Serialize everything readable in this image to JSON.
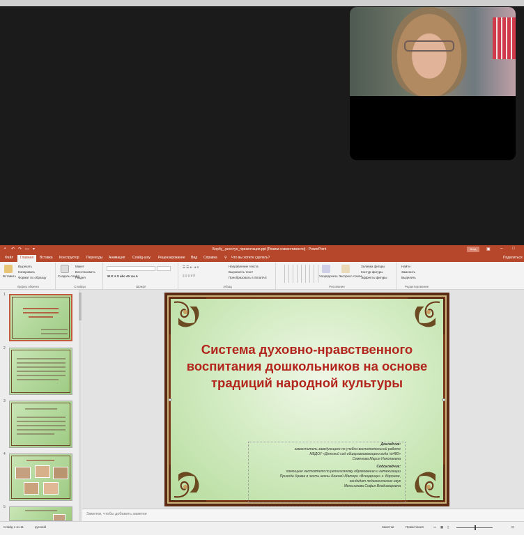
{
  "colors": {
    "accent": "#b7472a",
    "title_red": "#b3261e",
    "slide_bg": "#d4ecc4"
  },
  "titlebar": {
    "filename": "Борбу_.ресстуо_презентация.ppt [Режим совместимости] - PowerPoint",
    "signin": "Вход"
  },
  "tabs": [
    "Файл",
    "Главная",
    "Вставка",
    "Конструктор",
    "Переходы",
    "Анимация",
    "Слайд-шоу",
    "Рецензирование",
    "Вид",
    "Справка",
    "Что вы хотите сделать?"
  ],
  "share_label": "Поделиться",
  "ribbon": {
    "clipboard": {
      "paste": "Вставить",
      "cut": "Вырезать",
      "copy": "Копировать",
      "format": "Формат по образцу",
      "label": "Буфер обмена"
    },
    "slides": {
      "new_slide": "Создать слайд",
      "layout": "Макет",
      "reset": "Восстановить",
      "section": "Раздел",
      "label": "Слайды"
    },
    "font": {
      "label": "Шрифт"
    },
    "paragraph": {
      "dir": "Направление текста",
      "align": "Выровнять текст",
      "smartart": "Преобразовать в SmartArt",
      "label": "Абзац"
    },
    "drawing": {
      "arrange": "Упорядочить",
      "styles": "Экспресс-стили",
      "fill": "Заливка фигуры",
      "outline": "Контур фигуры",
      "effects": "Эффекты фигуры",
      "label": "Рисование"
    },
    "editing": {
      "find": "Найти",
      "replace": "Заменить",
      "select": "Выделить",
      "label": "Редактирование"
    }
  },
  "thumbnails": [
    {
      "num": "1"
    },
    {
      "num": "2"
    },
    {
      "num": "3"
    },
    {
      "num": "4"
    },
    {
      "num": "5"
    }
  ],
  "slide": {
    "title": "Система духовно-нравственного воспитания дошкольников на основе традиций народной культуры",
    "info_lines": [
      "Докладчик:",
      "заместитель заведующего по учебно-воспитательной работе",
      "МБДОУ «Детский сад общеразвивающего вида №480»",
      "Семенова Мария Николаевна",
      "Содокладчик:",
      "помощник настоятеля по религиозному образованию и катехизации",
      "Прихода Храма в честь иконы Божией Матери «Всецарица» г. Воронеж,",
      "кандидат педагогических наук",
      "Мельникова Софья Владимировна"
    ]
  },
  "notes_placeholder": "Заметки, чтобы добавить заметки",
  "status": {
    "slide_info": "Слайд 1 из 11",
    "language": "русский",
    "notes_btn": "Заметки",
    "comments_btn": "Примечания"
  }
}
